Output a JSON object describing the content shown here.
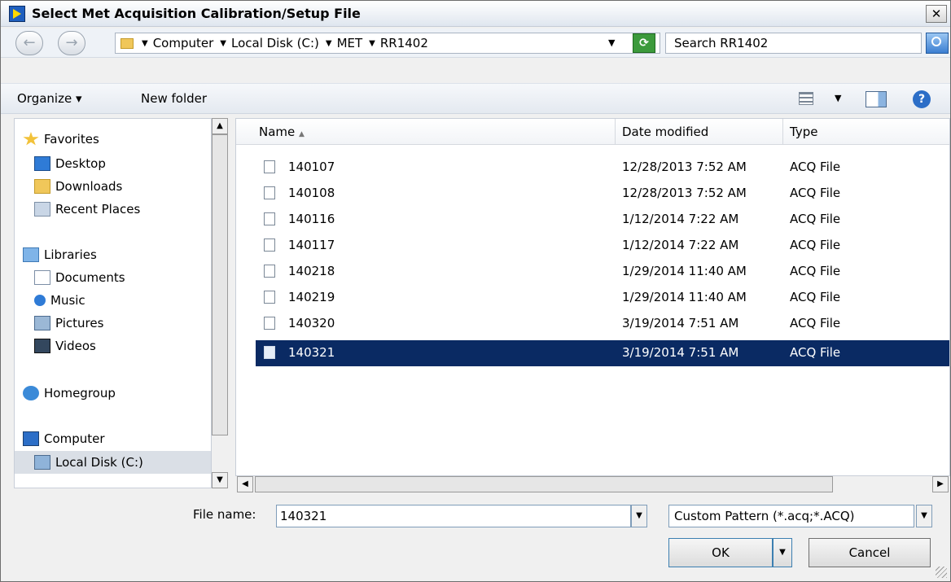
{
  "window": {
    "title": "Select Met Acquisition Calibration/Setup File",
    "close_label": "✕"
  },
  "address": {
    "crumbs": [
      "Computer",
      "Local Disk (C:)",
      "MET",
      "RR1402"
    ],
    "search_placeholder": "Search RR1402"
  },
  "toolbar": {
    "organize": "Organize ▾",
    "new_folder": "New folder"
  },
  "nav": {
    "favorites": "Favorites",
    "desktop": "Desktop",
    "downloads": "Downloads",
    "recent": "Recent Places",
    "libraries": "Libraries",
    "documents": "Documents",
    "music": "Music",
    "pictures": "Pictures",
    "videos": "Videos",
    "homegroup": "Homegroup",
    "computer": "Computer",
    "local_disk": "Local Disk (C:)"
  },
  "columns": {
    "name": "Name",
    "sort_glyph": "▲",
    "date": "Date modified",
    "type": "Type"
  },
  "files": [
    {
      "name": "140107",
      "date": "12/28/2013 7:52 AM",
      "type": "ACQ File"
    },
    {
      "name": "140108",
      "date": "12/28/2013 7:52 AM",
      "type": "ACQ File"
    },
    {
      "name": "140116",
      "date": "1/12/2014 7:22 AM",
      "type": "ACQ File"
    },
    {
      "name": "140117",
      "date": "1/12/2014 7:22 AM",
      "type": "ACQ File"
    },
    {
      "name": "140218",
      "date": "1/29/2014 11:40 AM",
      "type": "ACQ File"
    },
    {
      "name": "140219",
      "date": "1/29/2014 11:40 AM",
      "type": "ACQ File"
    },
    {
      "name": "140320",
      "date": "3/19/2014 7:51 AM",
      "type": "ACQ File"
    },
    {
      "name": "140321",
      "date": "3/19/2014 7:51 AM",
      "type": "ACQ File"
    }
  ],
  "bottom": {
    "file_name_label": "File name:",
    "file_name_value": "140321",
    "file_type_value": "Custom Pattern (*.acq;*.ACQ)",
    "ok_label": "OK",
    "cancel_label": "Cancel"
  }
}
